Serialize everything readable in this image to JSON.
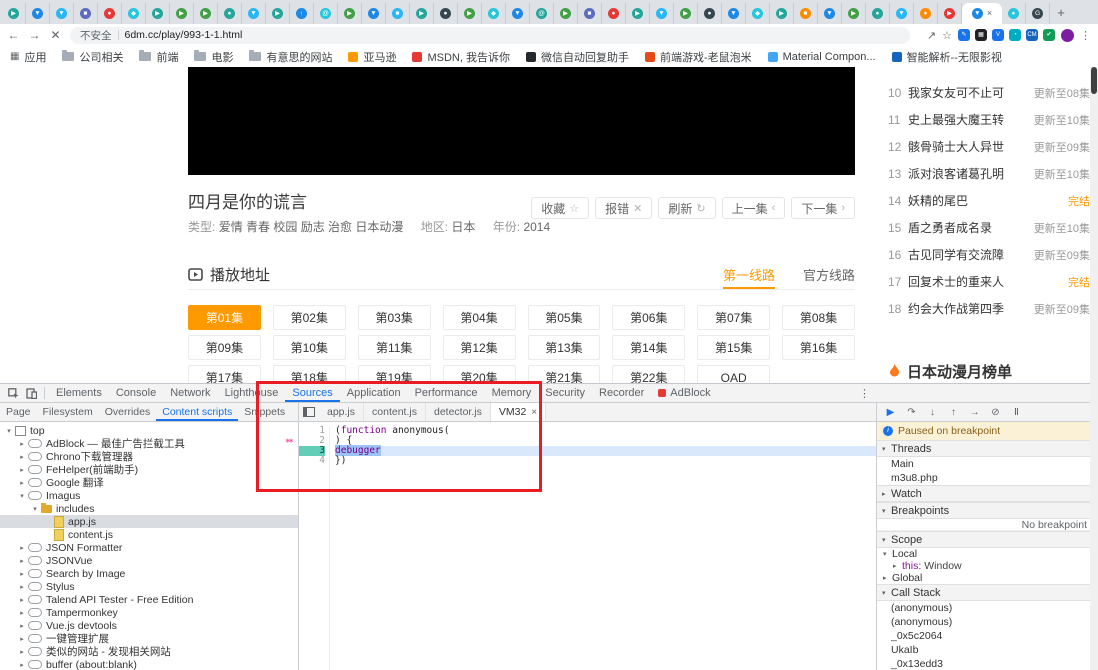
{
  "browser": {
    "tabs": {
      "active_index": 40,
      "close_glyph": "×",
      "new_tab_glyph": "+",
      "favicons": [
        {
          "c": "#26a69a",
          "g": "▶"
        },
        {
          "c": "#1e88e5",
          "g": "▼"
        },
        {
          "c": "#29b6f6",
          "g": "▼"
        },
        {
          "c": "#5c6bc0",
          "g": "■"
        },
        {
          "c": "#e53935",
          "g": "●"
        },
        {
          "c": "#26c6da",
          "g": "◆"
        },
        {
          "c": "#26a69a",
          "g": "▶"
        },
        {
          "c": "#43a047",
          "g": "▶"
        },
        {
          "c": "#43a047",
          "g": "▶"
        },
        {
          "c": "#26a69a",
          "g": "●"
        },
        {
          "c": "#29b6f6",
          "g": "▼"
        },
        {
          "c": "#26a69a",
          "g": "▶"
        },
        {
          "c": "#1e88e5",
          "g": "↑"
        },
        {
          "c": "#26c6da",
          "g": "@"
        },
        {
          "c": "#43a047",
          "g": "▶"
        },
        {
          "c": "#1e88e5",
          "g": "▼"
        },
        {
          "c": "#29b6f6",
          "g": "■"
        },
        {
          "c": "#26a69a",
          "g": "▶"
        },
        {
          "c": "#37474f",
          "g": "●"
        },
        {
          "c": "#43a047",
          "g": "▶"
        },
        {
          "c": "#26c6da",
          "g": "◆"
        },
        {
          "c": "#1e88e5",
          "g": "▼"
        },
        {
          "c": "#26a69a",
          "g": "@"
        },
        {
          "c": "#43a047",
          "g": "▶"
        },
        {
          "c": "#5c6bc0",
          "g": "■"
        },
        {
          "c": "#e53935",
          "g": "●"
        },
        {
          "c": "#26a69a",
          "g": "▶"
        },
        {
          "c": "#29b6f6",
          "g": "▼"
        },
        {
          "c": "#43a047",
          "g": "▶"
        },
        {
          "c": "#37474f",
          "g": "●"
        },
        {
          "c": "#1e88e5",
          "g": "▼"
        },
        {
          "c": "#26c6da",
          "g": "◆"
        },
        {
          "c": "#26a69a",
          "g": "▶"
        },
        {
          "c": "#fb8c00",
          "g": "■"
        },
        {
          "c": "#1e88e5",
          "g": "▼"
        },
        {
          "c": "#43a047",
          "g": "▶"
        },
        {
          "c": "#26a69a",
          "g": "●"
        },
        {
          "c": "#29b6f6",
          "g": "▼"
        },
        {
          "c": "#fb8c00",
          "g": "●"
        },
        {
          "c": "#e53935",
          "g": "▶"
        },
        {
          "c": "#1e88e5",
          "g": "▼"
        },
        {
          "c": "#26c6da",
          "g": "●"
        },
        {
          "c": "#37474f",
          "g": "G"
        }
      ]
    },
    "nav": {
      "back": "←",
      "forward": "→",
      "stop": "✕"
    },
    "address": {
      "security": "不安全",
      "url": "6dm.cc/play/993-1-1.html"
    },
    "toolbar": {
      "share": "↗",
      "star": "☆",
      "menu": "⋮",
      "avatar": "",
      "ext_icons": [
        {
          "g": "✎",
          "c": "#1a73e8"
        },
        {
          "g": "▦",
          "c": "#202124"
        },
        {
          "g": "V",
          "c": "#1a73e8"
        },
        {
          "g": "◔",
          "c": "#00acc1"
        },
        {
          "g": "CM",
          "c": "#1565c0"
        },
        {
          "g": "✔",
          "c": "#0f9d58"
        }
      ]
    },
    "bookmarks": [
      {
        "label": "应用",
        "t": "glyph",
        "g": "▦",
        "c": "#5f6368"
      },
      {
        "label": "公司相关",
        "t": "folder"
      },
      {
        "label": "前端",
        "t": "folder"
      },
      {
        "label": "电影",
        "t": "folder"
      },
      {
        "label": "有意思的网站",
        "t": "folder"
      },
      {
        "label": "亚马逊",
        "t": "dot",
        "c": "#ff9900"
      },
      {
        "label": "MSDN, 我告诉你",
        "t": "dot",
        "c": "#e53935"
      },
      {
        "label": "微信自动回复助手",
        "t": "dot",
        "c": "#24292e"
      },
      {
        "label": "前端游戏-老鼠泡米",
        "t": "dot",
        "c": "#e64a19"
      },
      {
        "label": "Material Compon...",
        "t": "dot",
        "c": "#42a5f5"
      },
      {
        "label": "智能解析--无限影视",
        "t": "dot",
        "c": "#1565c0"
      }
    ]
  },
  "page": {
    "title": "四月是你的谎言",
    "meta": {
      "type_label": "类型:",
      "type_value": "爱情 青春 校园 励志 治愈 日本动漫",
      "region_label": "地区:",
      "region_value": "日本",
      "year_label": "年份:",
      "year_value": "2014"
    },
    "actions": [
      {
        "label": "收藏",
        "icon": "☆"
      },
      {
        "label": "报错",
        "icon": "✕"
      },
      {
        "label": "刷新",
        "icon": "↻"
      },
      {
        "label": "上一集",
        "icon": "‹"
      },
      {
        "label": "下一集",
        "icon": "›"
      }
    ],
    "play": {
      "title": "播放地址",
      "tabs": [
        {
          "label": "第一线路",
          "cls": "active"
        },
        {
          "label": "官方线路",
          "cls": ""
        }
      ]
    },
    "episodes": [
      {
        "label": "第01集",
        "cls": "active"
      },
      {
        "label": "第02集",
        "cls": ""
      },
      {
        "label": "第03集",
        "cls": ""
      },
      {
        "label": "第04集",
        "cls": ""
      },
      {
        "label": "第05集",
        "cls": ""
      },
      {
        "label": "第06集",
        "cls": ""
      },
      {
        "label": "第07集",
        "cls": ""
      },
      {
        "label": "第08集",
        "cls": ""
      },
      {
        "label": "第09集",
        "cls": ""
      },
      {
        "label": "第10集",
        "cls": ""
      },
      {
        "label": "第11集",
        "cls": ""
      },
      {
        "label": "第12集",
        "cls": ""
      },
      {
        "label": "第13集",
        "cls": ""
      },
      {
        "label": "第14集",
        "cls": ""
      },
      {
        "label": "第15集",
        "cls": ""
      },
      {
        "label": "第16集",
        "cls": ""
      },
      {
        "label": "第17集",
        "cls": ""
      },
      {
        "label": "第18集",
        "cls": ""
      },
      {
        "label": "第19集",
        "cls": ""
      },
      {
        "label": "第20集",
        "cls": ""
      },
      {
        "label": "第21集",
        "cls": ""
      },
      {
        "label": "第22集",
        "cls": ""
      },
      {
        "label": "OAD",
        "cls": ""
      }
    ],
    "ranking": {
      "title": "日本动漫月榜单",
      "items": [
        {
          "rank": "10",
          "title": "我家女友可不止可",
          "status": "更新至08集",
          "cls": ""
        },
        {
          "rank": "11",
          "title": "史上最强大魔王转",
          "status": "更新至10集",
          "cls": ""
        },
        {
          "rank": "12",
          "title": "骸骨骑士大人异世",
          "status": "更新至09集",
          "cls": ""
        },
        {
          "rank": "13",
          "title": "派对浪客诸葛孔明",
          "status": "更新至10集",
          "cls": ""
        },
        {
          "rank": "14",
          "title": "妖精的尾巴",
          "status": "完结",
          "cls": "done"
        },
        {
          "rank": "15",
          "title": "盾之勇者成名录",
          "status": "更新至10集",
          "cls": ""
        },
        {
          "rank": "16",
          "title": "古见同学有交流障",
          "status": "更新至09集",
          "cls": ""
        },
        {
          "rank": "17",
          "title": "回复术士的重来人",
          "status": "完结",
          "cls": "done"
        },
        {
          "rank": "18",
          "title": "约会大作战第四季",
          "status": "更新至09集",
          "cls": ""
        }
      ]
    }
  },
  "devtools": {
    "close_glyph": "×",
    "more_glyph": "⋮",
    "tri_open": "▾",
    "tri_closed": "▸",
    "tabs": [
      {
        "label": "Elements",
        "cls": ""
      },
      {
        "label": "Console",
        "cls": ""
      },
      {
        "label": "Network",
        "cls": ""
      },
      {
        "label": "Lighthouse",
        "cls": ""
      },
      {
        "label": "Sources",
        "cls": "active"
      },
      {
        "label": "Application",
        "cls": ""
      },
      {
        "label": "Performance",
        "cls": ""
      },
      {
        "label": "Memory",
        "cls": ""
      },
      {
        "label": "Security",
        "cls": ""
      },
      {
        "label": "Recorder",
        "cls": ""
      },
      {
        "label": "AdBlock",
        "cls": "adblock"
      }
    ],
    "left_tabs": [
      {
        "label": "Page",
        "cls": ""
      },
      {
        "label": "Filesystem",
        "cls": ""
      },
      {
        "label": "Overrides",
        "cls": ""
      },
      {
        "label": "Content scripts",
        "cls": "active"
      },
      {
        "label": "Snippets",
        "cls": ""
      }
    ],
    "tree": [
      {
        "d": 0,
        "a": "▾",
        "i": "frame",
        "t": "top"
      },
      {
        "d": 1,
        "a": "▸",
        "i": "cloud",
        "t": "AdBlock — 最佳广告拦截工具"
      },
      {
        "d": 1,
        "a": "▸",
        "i": "cloud",
        "t": "Chrono下载管理器"
      },
      {
        "d": 1,
        "a": "▸",
        "i": "cloud",
        "t": "FeHelper(前端助手)"
      },
      {
        "d": 1,
        "a": "▸",
        "i": "cloud",
        "t": "Google 翻译"
      },
      {
        "d": 1,
        "a": "▾",
        "i": "cloud",
        "t": "Imagus"
      },
      {
        "d": 2,
        "a": "▾",
        "i": "folder",
        "t": "includes"
      },
      {
        "d": 3,
        "a": "",
        "i": "file",
        "t": "app.js",
        "sel": true
      },
      {
        "d": 3,
        "a": "",
        "i": "file",
        "t": "content.js"
      },
      {
        "d": 1,
        "a": "▸",
        "i": "cloud",
        "t": "JSON Formatter"
      },
      {
        "d": 1,
        "a": "▸",
        "i": "cloud",
        "t": "JSONVue"
      },
      {
        "d": 1,
        "a": "▸",
        "i": "cloud",
        "t": "Search by Image"
      },
      {
        "d": 1,
        "a": "▸",
        "i": "cloud",
        "t": "Stylus"
      },
      {
        "d": 1,
        "a": "▸",
        "i": "cloud",
        "t": "Talend API Tester - Free Edition"
      },
      {
        "d": 1,
        "a": "▸",
        "i": "cloud",
        "t": "Tampermonkey"
      },
      {
        "d": 1,
        "a": "▸",
        "i": "cloud",
        "t": "Vue.js devtools"
      },
      {
        "d": 1,
        "a": "▸",
        "i": "cloud",
        "t": "一键管理扩展"
      },
      {
        "d": 1,
        "a": "▸",
        "i": "cloud",
        "t": "类似的网站 - 发现相关网站"
      },
      {
        "d": 1,
        "a": "▸",
        "i": "cloud",
        "t": "buffer (about:blank)"
      }
    ],
    "editor_tabs": [
      {
        "label": "app.js",
        "cls": ""
      },
      {
        "label": "content.js",
        "cls": ""
      },
      {
        "label": "detector.js",
        "cls": ""
      },
      {
        "label": "VM32",
        "cls": "active"
      }
    ],
    "code": {
      "n1": "1",
      "n2": "2",
      "n3": "3",
      "n4": "4",
      "l1a": "(",
      "l1b": "function",
      "l1c": " anonymous(",
      "l2": ") {",
      "l3": "debugger",
      "l4": "})",
      "gutter_marks": "**"
    },
    "debugger": {
      "paused_text": "Paused on breakpoint",
      "controls": [
        {
          "n": "resume-button",
          "g": "▶",
          "cls": "resume"
        },
        {
          "n": "step-over-button",
          "g": "↷",
          "cls": ""
        },
        {
          "n": "step-into-button",
          "g": "↓",
          "cls": ""
        },
        {
          "n": "step-out-button",
          "g": "↑",
          "cls": ""
        },
        {
          "n": "step-button",
          "g": "→",
          "cls": ""
        },
        {
          "n": "deactivate-breakpoints-button",
          "g": "⊘",
          "cls": ""
        },
        {
          "n": "pause-on-exceptions-button",
          "g": "Ⅱ",
          "cls": ""
        }
      ],
      "threads": {
        "label": "Threads",
        "rows": [
          "Main",
          "m3u8.php"
        ]
      },
      "watch": {
        "label": "Watch"
      },
      "breakpoints": {
        "label": "Breakpoints",
        "empty": "No breakpoint"
      },
      "scope": {
        "label": "Scope",
        "local": "Local",
        "this_name": "this:",
        "this_value": "Window",
        "global": "Global"
      },
      "callstack": {
        "label": "Call Stack",
        "rows": [
          "(anonymous)",
          "(anonymous)",
          "_0x5c2064",
          "UkaIb",
          "_0x13edd3"
        ]
      }
    }
  }
}
